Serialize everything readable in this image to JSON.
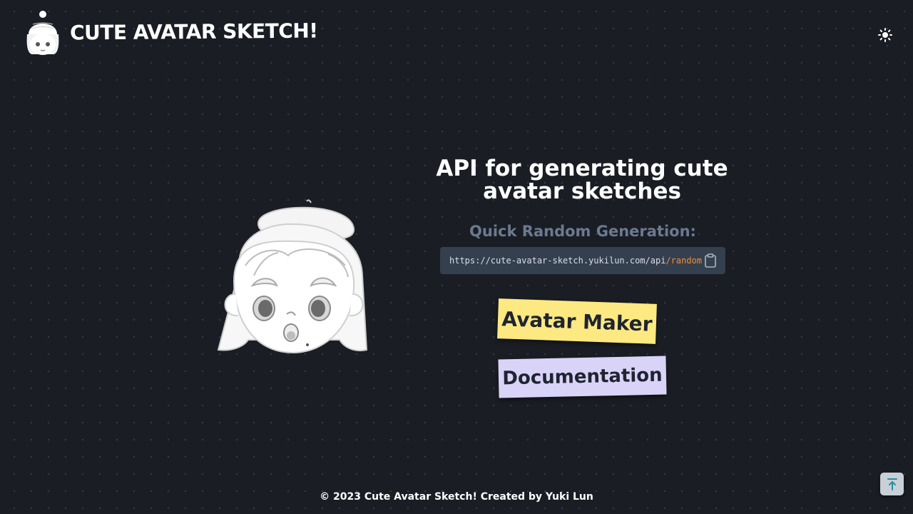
{
  "header": {
    "brand": "CUTE AVATAR SKETCH!",
    "logo_icon": "avatar-logo-icon",
    "theme_toggle_icon": "sun-icon"
  },
  "hero": {
    "title_line1": "API for generating cute",
    "title_line2": "avatar sketches",
    "quick_label": "Quick Random Generation:",
    "api_url_base": "https://cute-avatar-sketch.yukilun.com/api",
    "api_url_path": "/random",
    "copy_icon": "clipboard-icon",
    "avatar_image": "sketch-avatar-girl-beret"
  },
  "buttons": {
    "maker_label": "Avatar Maker",
    "docs_label": "Documentation"
  },
  "footer": {
    "text": "© 2023 Cute Avatar Sketch! Created by Yuki Lun"
  },
  "scroll_top_icon": "arrow-up-to-line-icon",
  "colors": {
    "background": "#1a1d24",
    "api_box": "#35404f",
    "accent": "#f28c3c",
    "maker_button": "#fde981",
    "docs_button": "#d9d3f8",
    "muted_label": "#6b7a8f",
    "scroll_button": "#c9cfd6",
    "scroll_icon": "#2a8c9c"
  }
}
